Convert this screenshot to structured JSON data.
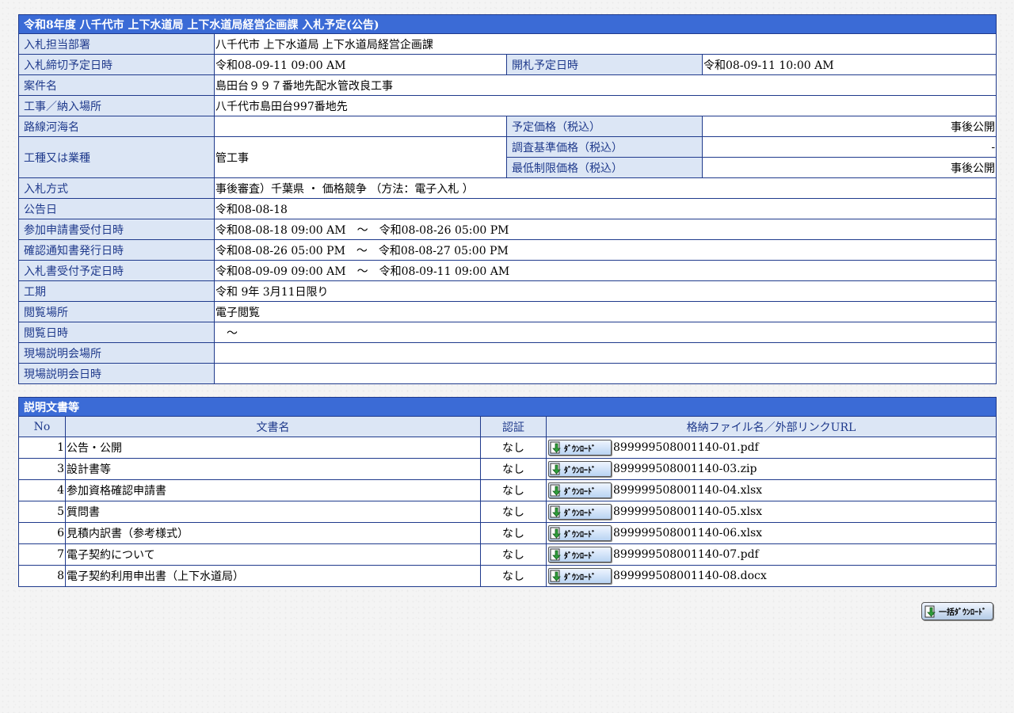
{
  "info": {
    "title": "令和8年度 八千代市 上下水道局 上下水道局経営企画課 入札予定(公告)",
    "dept_label": "入札担当部署",
    "dept_value": "八千代市 上下水道局 上下水道局経営企画課",
    "deadline_label": "入札締切予定日時",
    "deadline_value": "令和08-09-11 09:00 AM",
    "opening_label": "開札予定日時",
    "opening_value": "令和08-09-11 10:00 AM",
    "project_label": "案件名",
    "project_value": "島田台９９７番地先配水管改良工事",
    "location_label": "工事／納入場所",
    "location_value": "八千代市島田台997番地先",
    "route_label": "路線河海名",
    "route_value": "",
    "planned_price_label": "予定価格（税込）",
    "planned_price_value": "事後公開",
    "work_type_label": "工種又は業種",
    "work_type_value": "管工事",
    "survey_price_label": "調査基準価格（税込）",
    "survey_price_value": "-",
    "min_price_label": "最低制限価格（税込）",
    "min_price_value": "事後公開",
    "method_label": "入札方式",
    "method_value": "事後審査）千葉県 ・ 価格競争 （方法：電子入札 ）",
    "notice_date_label": "公告日",
    "notice_date_value": "令和08-08-18",
    "application_label": "参加申請書受付日時",
    "application_value": "令和08-08-18 09:00 AM　～　令和08-08-26 05:00 PM",
    "confirmation_label": "確認通知書発行日時",
    "confirmation_value": "令和08-08-26 05:00 PM　～　令和08-08-27 05:00 PM",
    "bid_accept_label": "入札書受付予定日時",
    "bid_accept_value": "令和08-09-09 09:00 AM　～　令和08-09-11 09:00 AM",
    "period_label": "工期",
    "period_value": "令和 9年 3月11日限り",
    "viewing_place_label": "閲覧場所",
    "viewing_place_value": "電子閲覧",
    "viewing_date_label": "閲覧日時",
    "viewing_date_value": "　～",
    "site_place_label": "現場説明会場所",
    "site_place_value": "",
    "site_date_label": "現場説明会日時",
    "site_date_value": ""
  },
  "docs": {
    "title": "説明文書等",
    "headers": {
      "no": "No",
      "name": "文書名",
      "cert": "認証",
      "file": "格納ファイル名／外部リンクURL"
    },
    "download_label": "ﾀﾞｳﾝﾛｰﾄﾞ",
    "rows": [
      {
        "no": "1",
        "name": "公告・公開",
        "cert": "なし",
        "file": "899999508001140-01.pdf"
      },
      {
        "no": "3",
        "name": "設計書等",
        "cert": "なし",
        "file": "899999508001140-03.zip"
      },
      {
        "no": "4",
        "name": "参加資格確認申請書",
        "cert": "なし",
        "file": "899999508001140-04.xlsx"
      },
      {
        "no": "5",
        "name": "質問書",
        "cert": "なし",
        "file": "899999508001140-05.xlsx"
      },
      {
        "no": "6",
        "name": "見積内訳書（参考様式）",
        "cert": "なし",
        "file": "899999508001140-06.xlsx"
      },
      {
        "no": "7",
        "name": "電子契約について",
        "cert": "なし",
        "file": "899999508001140-07.pdf"
      },
      {
        "no": "8",
        "name": "電子契約利用申出書（上下水道局）",
        "cert": "なし",
        "file": "899999508001140-08.docx"
      }
    ]
  },
  "bulk_download_label": "一括ﾀﾞｳﾝﾛｰﾄﾞ",
  "icons": {
    "download": "download-arrow-icon"
  },
  "colors": {
    "header_blue": "#3b6bd6",
    "label_bg": "#dce6f5",
    "border": "#1f3a8c"
  }
}
